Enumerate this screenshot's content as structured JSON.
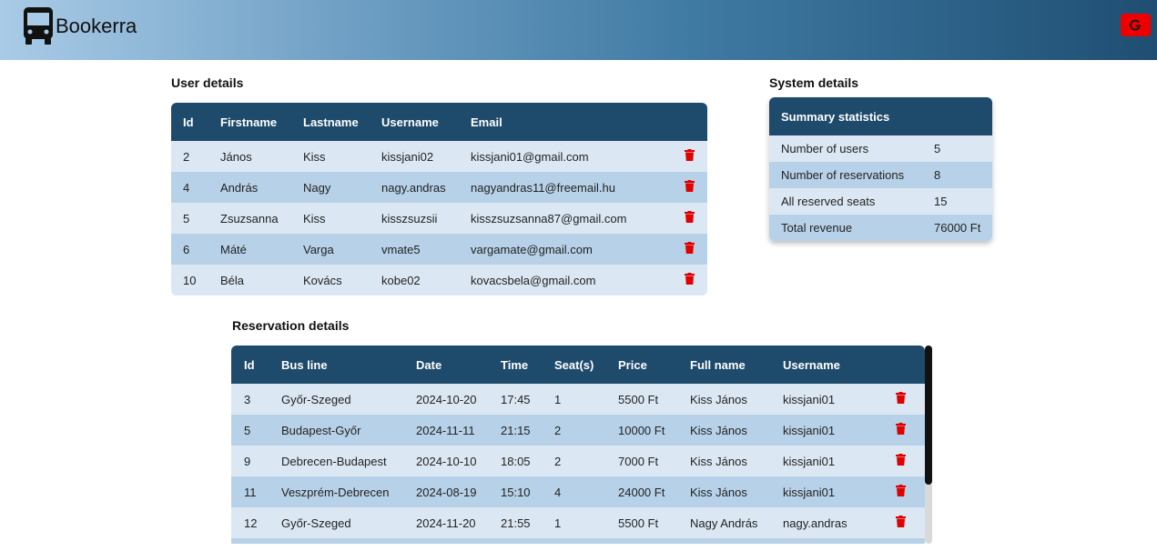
{
  "app": {
    "brand": "Bookerra",
    "logout_label": "G"
  },
  "colors": {
    "header_dark": "#1e4a6b",
    "row_light": "#dbe8f3",
    "row_dark": "#b7d2e8",
    "delete_red": "#e00000"
  },
  "users": {
    "title": "User details",
    "columns": [
      "Id",
      "Firstname",
      "Lastname",
      "Username",
      "Email"
    ],
    "rows": [
      {
        "id": "2",
        "firstname": "János",
        "lastname": "Kiss",
        "username": "kissjani02",
        "email": "kissjani01@gmail.com"
      },
      {
        "id": "4",
        "firstname": "András",
        "lastname": "Nagy",
        "username": "nagy.andras",
        "email": "nagyandras11@freemail.hu"
      },
      {
        "id": "5",
        "firstname": "Zsuzsanna",
        "lastname": "Kiss",
        "username": "kisszsuzsii",
        "email": "kisszsuzsanna87@gmail.com"
      },
      {
        "id": "6",
        "firstname": "Máté",
        "lastname": "Varga",
        "username": "vmate5",
        "email": "vargamate@gmail.com"
      },
      {
        "id": "10",
        "firstname": "Béla",
        "lastname": "Kovács",
        "username": "kobe02",
        "email": "kovacsbela@gmail.com"
      }
    ]
  },
  "system": {
    "title": "System details",
    "header": "Summary statistics",
    "rows": [
      {
        "label": "Number of users",
        "value": "5"
      },
      {
        "label": "Number of reservations",
        "value": "8"
      },
      {
        "label": "All reserved seats",
        "value": "15"
      },
      {
        "label": "Total revenue",
        "value": "76000 Ft"
      }
    ]
  },
  "reservations": {
    "title": "Reservation details",
    "columns": [
      "Id",
      "Bus line",
      "Date",
      "Time",
      "Seat(s)",
      "Price",
      "Full name",
      "Username"
    ],
    "rows": [
      {
        "id": "3",
        "bus_line": "Győr-Szeged",
        "date": "2024-10-20",
        "time": "17:45",
        "seats": "1",
        "price": "5500 Ft",
        "full_name": "Kiss János",
        "username": "kissjani01"
      },
      {
        "id": "5",
        "bus_line": "Budapest-Győr",
        "date": "2024-11-11",
        "time": "21:15",
        "seats": "2",
        "price": "10000 Ft",
        "full_name": "Kiss János",
        "username": "kissjani01"
      },
      {
        "id": "9",
        "bus_line": "Debrecen-Budapest",
        "date": "2024-10-10",
        "time": "18:05",
        "seats": "2",
        "price": "7000 Ft",
        "full_name": "Kiss János",
        "username": "kissjani01"
      },
      {
        "id": "11",
        "bus_line": "Veszprém-Debrecen",
        "date": "2024-08-19",
        "time": "15:10",
        "seats": "4",
        "price": "24000 Ft",
        "full_name": "Kiss János",
        "username": "kissjani01"
      },
      {
        "id": "12",
        "bus_line": "Győr-Szeged",
        "date": "2024-11-20",
        "time": "21:55",
        "seats": "1",
        "price": "5500 Ft",
        "full_name": "Nagy András",
        "username": "nagy.andras"
      }
    ]
  }
}
